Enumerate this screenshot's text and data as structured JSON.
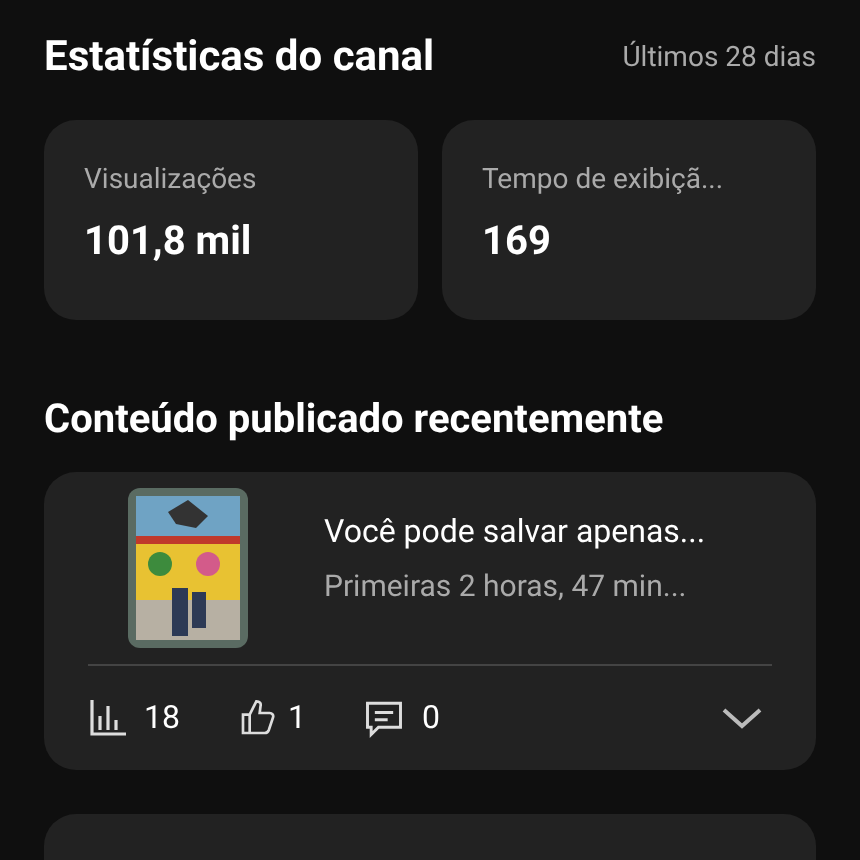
{
  "header": {
    "title": "Estatísticas do canal",
    "period": "Últimos 28 dias"
  },
  "stats": [
    {
      "label": "Visualizações",
      "value": "101,8 mil"
    },
    {
      "label": "Tempo de exibiçã...",
      "value": "169"
    }
  ],
  "recent": {
    "title": "Conteúdo publicado recentemente",
    "items": [
      {
        "title": "Você pode salvar apenas...",
        "subtitle": "Primeiras 2 horas, 47 min...",
        "views": "18",
        "likes": "1",
        "comments": "0",
        "expanded": false
      }
    ]
  }
}
